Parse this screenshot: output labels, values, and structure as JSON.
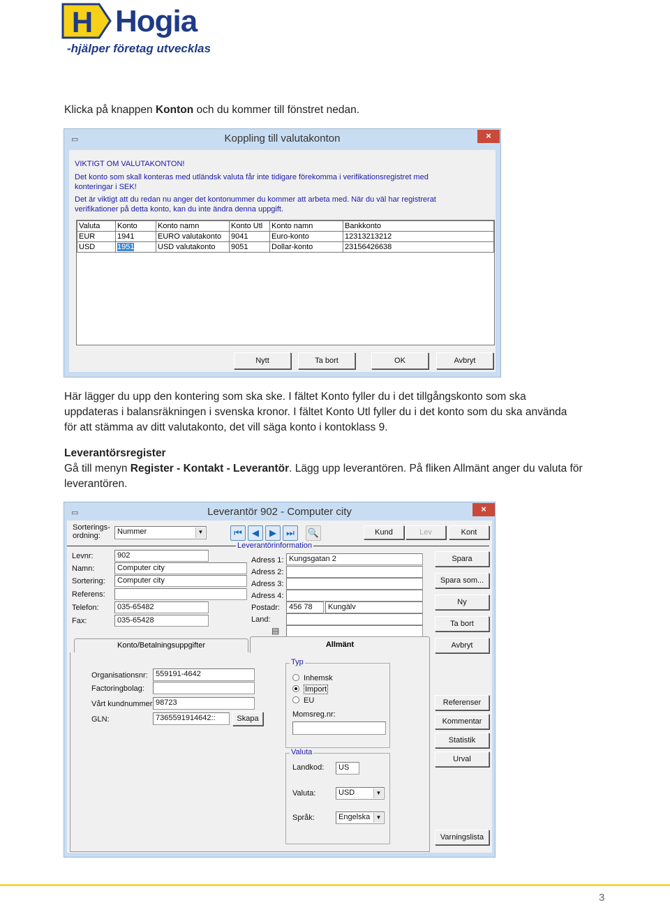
{
  "logo": {
    "letter": "H",
    "word": "Hogia",
    "tagline": "-hjälper företag utvecklas",
    "colors": {
      "yellow": "#f7d117",
      "navy": "#1f3b86"
    }
  },
  "intro": {
    "pre": "Klicka på knappen ",
    "bold": "Konton",
    "post": " och du kommer till fönstret nedan."
  },
  "dialog1": {
    "icon": "window-icon",
    "title": "Koppling till valutakonton",
    "close": "×",
    "warning_title": "VIKTIGT OM VALUTAKONTON!",
    "warning_1a": "Det konto som skall konteras med utländsk valuta får inte tidigare förekomma i  verifikationsregistret med",
    "warning_1b": "konteringar i SEK!",
    "warning_2a": "Det är viktigt att du redan nu anger det kontonummer du kommer att arbeta med. När du väl har registrerat",
    "warning_2b": "verifikationer på detta konto, kan du inte ändra denna uppgift.",
    "table": {
      "headers": [
        "Valuta",
        "Konto",
        "Konto namn",
        "Konto Utl",
        "Konto namn",
        "Bankkonto"
      ],
      "rows": [
        [
          "EUR",
          "1941",
          "EURO valutakonto",
          "9041",
          "Euro-konto",
          "12313213212"
        ],
        [
          "USD",
          "1951",
          "USD valutakonto",
          "9051",
          "Dollar-konto",
          "23156426638"
        ]
      ],
      "selected_cell": "1951"
    },
    "buttons": {
      "new": "Nytt",
      "delete": "Ta bort",
      "ok": "OK",
      "cancel": "Avbryt"
    }
  },
  "para2": {
    "line1": "Här lägger du upp den kontering som ska ske. I fältet Konto fyller du i det tillgångskonto som ska",
    "line2": "uppdateras i balansräkningen i svenska kronor. I fältet Konto Utl fyller du i det konto som du ska använda",
    "line3": "för att stämma av ditt valutakonto, det vill säga konto i kontoklass 9."
  },
  "section": {
    "heading": "Leverantörsregister",
    "pre": "Gå till menyn ",
    "bold": "Register - Kontakt - Leverantör",
    "post": ". Lägg upp leverantören. På fliken Allmänt anger du valuta för",
    "line2": "leverantören."
  },
  "dialog2": {
    "title": "Leverantör 902 - Computer city",
    "close": "×",
    "sort_label_1": "Sorterings-",
    "sort_label_2": "ordning:",
    "sort_value": "Nummer",
    "nav": {
      "first": "⏮",
      "prev": "◀",
      "next": "▶",
      "last": "⏭",
      "find": "🔍"
    },
    "top_buttons": {
      "kund": "Kund",
      "lev": "Lev",
      "kont": "Kont"
    },
    "group_label": "Leverantörinformation",
    "left_fields": [
      {
        "label": "Levnr:",
        "value": "902"
      },
      {
        "label": "Namn:",
        "value": "Computer city"
      },
      {
        "label": "Sortering:",
        "value": "Computer city"
      },
      {
        "label": "Referens:",
        "value": ""
      },
      {
        "label": "Telefon:",
        "value": "035-65482"
      },
      {
        "label": "Fax:",
        "value": "035-65428"
      }
    ],
    "address_fields": [
      {
        "label": "Adress 1:",
        "value": "Kungsgatan 2"
      },
      {
        "label": "Adress 2:",
        "value": ""
      },
      {
        "label": "Adress 3:",
        "value": ""
      },
      {
        "label": "Adress 4:",
        "value": ""
      }
    ],
    "postadr_label": "Postadr:",
    "postnr": "456 78",
    "ort": "Kungälv",
    "land_label": "Land:",
    "land_value": "",
    "side_buttons": {
      "spara": "Spara",
      "spara_som": "Spara som...",
      "ny": "Ny",
      "ta_bort": "Ta bort",
      "avbryt": "Avbryt",
      "referenser": "Referenser",
      "kommentar": "Kommentar",
      "statistik": "Statistik",
      "urval": "Urval",
      "varningslista": "Varningslista"
    },
    "tabs": [
      {
        "label": "Konto/Betalningsuppgifter",
        "active": false
      },
      {
        "label": "Allmänt",
        "active": true
      }
    ],
    "allmant": {
      "org_label": "Organisationsnr:",
      "org_value": "559191-4642",
      "factoring_label": "Factoringbolag:",
      "factoring_value": "",
      "kundnr_label": "Vårt kundnummer:",
      "kundnr_value": "98723",
      "gln_label": "GLN:",
      "gln_value": "7365591914642::",
      "skapa": "Skapa",
      "typ_title": "Typ",
      "typ_options": [
        {
          "label": "Inhemsk",
          "checked": false
        },
        {
          "label": "Import",
          "checked": true
        },
        {
          "label": "EU",
          "checked": false
        }
      ],
      "momsreg_label": "Momsreg.nr:",
      "momsreg_value": "",
      "valuta_title": "Valuta",
      "landkod_label": "Landkod:",
      "landkod_value": "US",
      "valuta_label": "Valuta:",
      "valuta_value": "USD",
      "sprak_label": "Språk:",
      "sprak_value": "Engelska"
    }
  },
  "footer": {
    "page_number": "3",
    "rule_color": "#f5d547"
  }
}
